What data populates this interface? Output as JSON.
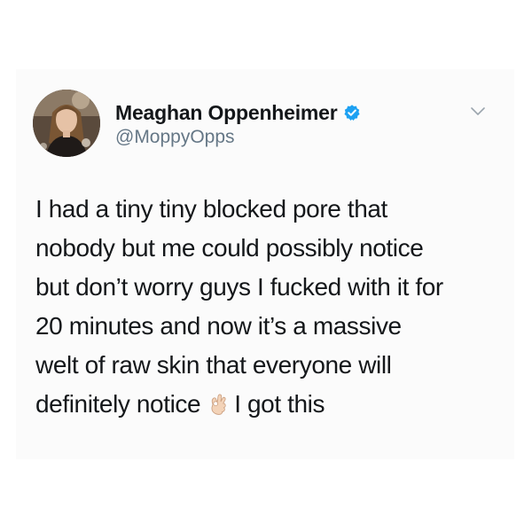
{
  "author": {
    "display_name": "Meaghan Oppenheimer",
    "handle": "@MoppyOpps",
    "verified_icon": "verified-badge-icon",
    "avatar": "profile-photo"
  },
  "menu": {
    "icon": "chevron-down-icon"
  },
  "tweet": {
    "lines": [
      "I had a tiny tiny blocked pore that",
      "nobody but me could possibly notice",
      "but don’t worry guys I fucked with it for",
      "20 minutes and now it’s a massive",
      "welt of raw skin that everyone will"
    ],
    "last_line_before_emoji": "definitely notice",
    "emoji": "ok-hand-icon",
    "last_line_after_emoji": "I got this"
  },
  "colors": {
    "text": "#14171a",
    "secondary": "#657786",
    "verified": "#1da1f2",
    "card_background": "#fbfbfb"
  }
}
